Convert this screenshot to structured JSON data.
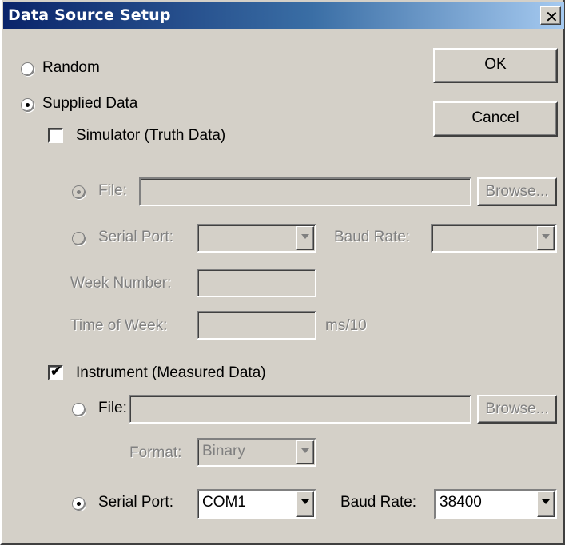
{
  "window": {
    "title": "Data Source Setup",
    "close_glyph": "✕"
  },
  "source": {
    "random_label": "Random",
    "supplied_label": "Supplied Data",
    "selected": "Supplied Data"
  },
  "buttons": {
    "ok": "OK",
    "cancel": "Cancel"
  },
  "simulator": {
    "checkbox_label": "Simulator (Truth Data)",
    "checked": false,
    "file_label": "File:",
    "file_value": "",
    "browse": "Browse...",
    "serial_label": "Serial Port:",
    "serial_value": "",
    "baud_label": "Baud Rate:",
    "baud_value": "",
    "week_label": "Week Number:",
    "week_value": "",
    "tow_label": "Time of Week:",
    "tow_value": "",
    "tow_unit": "ms/10"
  },
  "instrument": {
    "checkbox_label": "Instrument (Measured Data)",
    "checked": true,
    "check_glyph": "✔",
    "file_label": "File:",
    "file_value": "",
    "browse": "Browse...",
    "format_label": "Format:",
    "format_value": "Binary",
    "serial_label": "Serial Port:",
    "serial_value": "COM1",
    "baud_label": "Baud Rate:",
    "baud_value": "38400",
    "selected": "Serial Port"
  }
}
